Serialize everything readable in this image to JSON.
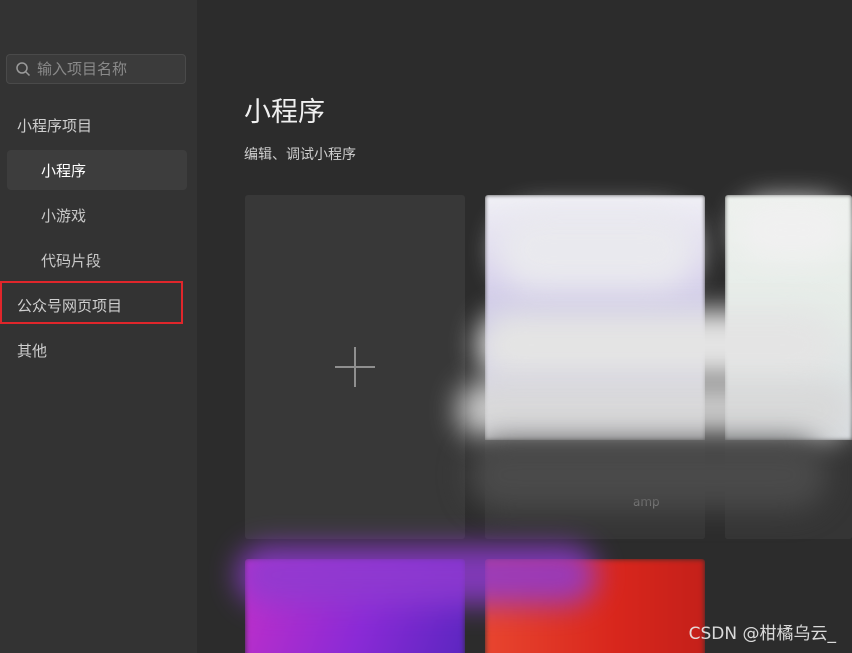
{
  "sidebar": {
    "search_placeholder": "输入项目名称",
    "groups": [
      {
        "label": "小程序项目"
      },
      {
        "label": "公众号网页项目"
      },
      {
        "label": "其他"
      }
    ],
    "sub_items": [
      {
        "label": "小程序",
        "active": true
      },
      {
        "label": "小游戏",
        "active": false
      },
      {
        "label": "代码片段",
        "active": false
      }
    ]
  },
  "main": {
    "title": "小程序",
    "subtitle": "编辑、调试小程序",
    "projects": [
      {
        "name": "amp"
      }
    ]
  },
  "watermark": "CSDN @柑橘乌云_",
  "colors": {
    "highlight_box": "#e0262b",
    "sidebar_bg": "#333333",
    "main_bg": "#2c2c2c"
  }
}
